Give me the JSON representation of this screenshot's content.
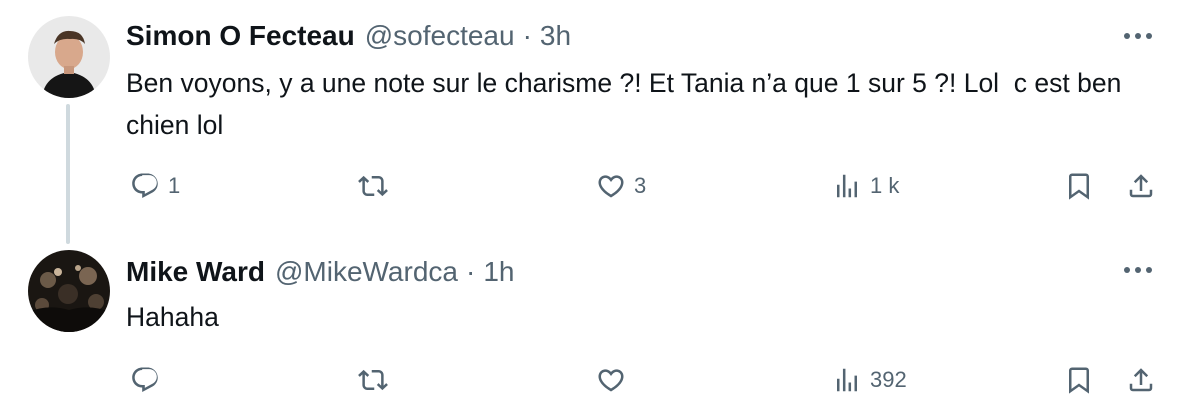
{
  "tweets": [
    {
      "name": "Simon O Fecteau",
      "handle": "@sofecteau",
      "separator": "·",
      "time": "3h",
      "text": "Ben voyons, y a une note sur le charisme ?! Et Tania n’a que 1 sur 5 ?! Lol  c est ben chien lol",
      "reply_count": "1",
      "retweet_count": "",
      "like_count": "3",
      "view_count": "1 k"
    },
    {
      "name": "Mike Ward",
      "handle": "@MikeWardca",
      "separator": "·",
      "time": "1h",
      "text": "Hahaha",
      "reply_count": "",
      "retweet_count": "",
      "like_count": "",
      "view_count": "392"
    }
  ],
  "icons": {
    "reply": "reply-icon",
    "retweet": "retweet-icon",
    "like": "heart-icon",
    "views": "views-icon",
    "bookmark": "bookmark-icon",
    "share": "share-icon",
    "more": "more-icon"
  },
  "colors": {
    "text": "#0f1419",
    "secondary": "#536471",
    "thread_line": "#cfd9de"
  }
}
